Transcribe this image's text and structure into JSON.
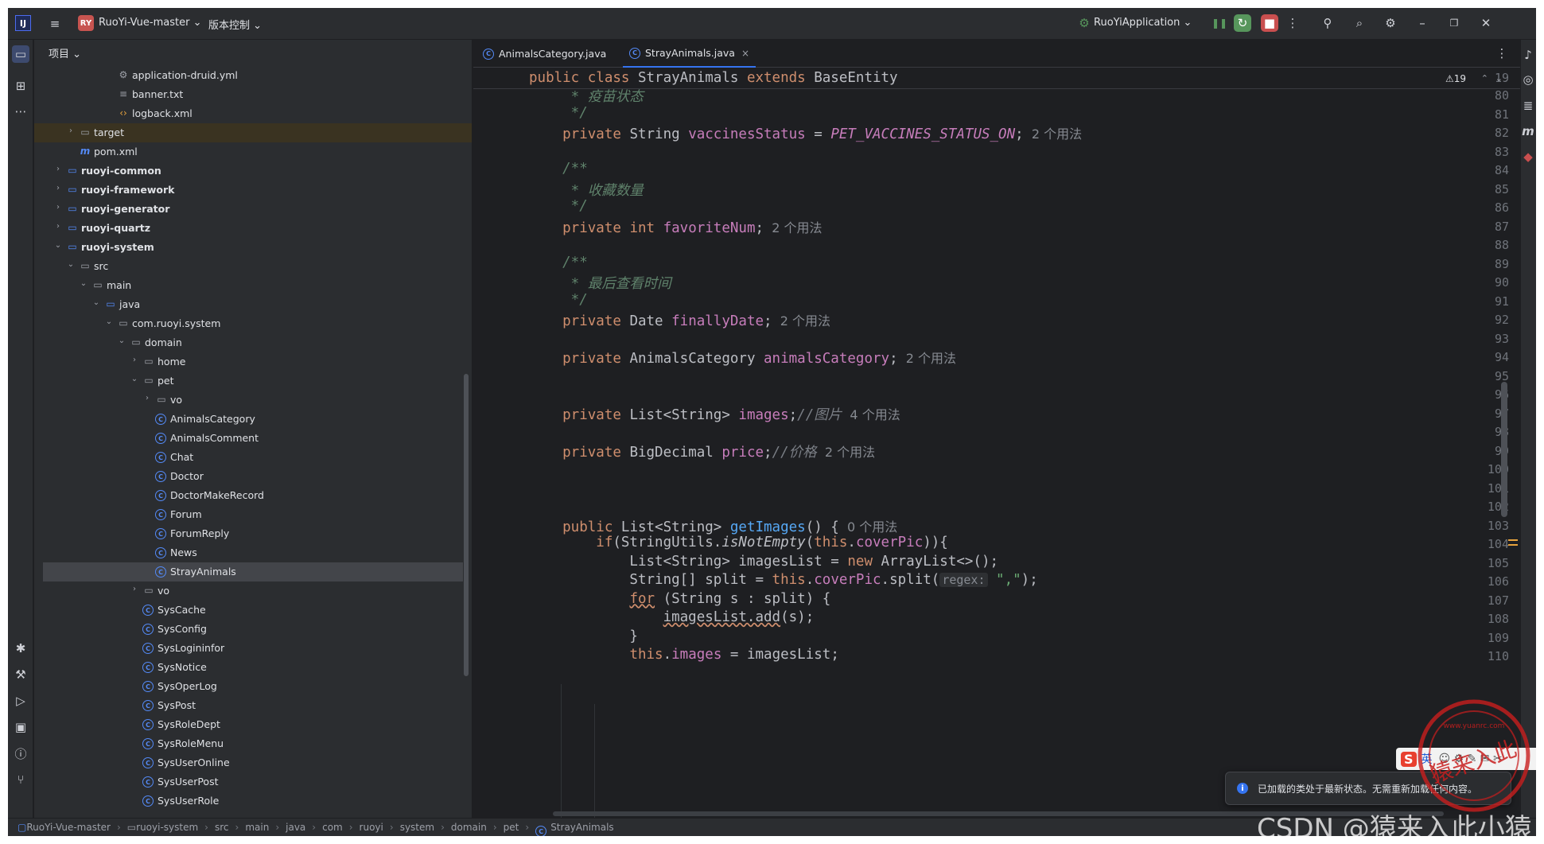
{
  "titlebar": {
    "logo": "IJ",
    "project_badge": "RY",
    "project_name": "RuoYi-Vue-master ⌄",
    "vcs_label": "版本控制 ⌄",
    "run_config": "RuoYiApplication ⌄",
    "icons": [
      "hamburger-icon",
      "run-config-icon",
      "debug-pause-icon",
      "rerun-icon",
      "stop-icon",
      "more-icon",
      "add-user-icon",
      "search-icon",
      "settings-icon",
      "minimize-icon",
      "maximize-icon",
      "close-icon"
    ]
  },
  "left_strip": {
    "icons": [
      "project-folder-icon",
      "structure-icon",
      "more-dots-icon",
      "debug-bug-icon",
      "build-hammer-icon",
      "services-play-icon",
      "terminal-icon",
      "problems-icon",
      "git-icon"
    ]
  },
  "project_panel": {
    "title": "项目 ⌄",
    "tree": [
      {
        "label": "application-druid.yml",
        "depth": 6,
        "icon": "yml",
        "arrow": ""
      },
      {
        "label": "banner.txt",
        "depth": 6,
        "icon": "txt",
        "arrow": ""
      },
      {
        "label": "logback.xml",
        "depth": 6,
        "icon": "xml",
        "arrow": ""
      },
      {
        "label": "target",
        "depth": 3,
        "icon": "folder",
        "arrow": "›",
        "excluded": true
      },
      {
        "label": "pom.xml",
        "depth": 3,
        "icon": "maven",
        "arrow": ""
      },
      {
        "label": "ruoyi-common",
        "depth": 2,
        "icon": "module",
        "arrow": "›",
        "bold": true
      },
      {
        "label": "ruoyi-framework",
        "depth": 2,
        "icon": "module",
        "arrow": "›",
        "bold": true
      },
      {
        "label": "ruoyi-generator",
        "depth": 2,
        "icon": "module",
        "arrow": "›",
        "bold": true
      },
      {
        "label": "ruoyi-quartz",
        "depth": 2,
        "icon": "module",
        "arrow": "›",
        "bold": true
      },
      {
        "label": "ruoyi-system",
        "depth": 2,
        "icon": "module",
        "arrow": "⌄",
        "bold": true
      },
      {
        "label": "src",
        "depth": 3,
        "icon": "folder",
        "arrow": "⌄"
      },
      {
        "label": "main",
        "depth": 4,
        "icon": "folder",
        "arrow": "⌄"
      },
      {
        "label": "java",
        "depth": 5,
        "icon": "module",
        "arrow": "⌄"
      },
      {
        "label": "com.ruoyi.system",
        "depth": 6,
        "icon": "package",
        "arrow": "⌄"
      },
      {
        "label": "domain",
        "depth": 7,
        "icon": "package",
        "arrow": "⌄"
      },
      {
        "label": "home",
        "depth": 8,
        "icon": "package",
        "arrow": "›"
      },
      {
        "label": "pet",
        "depth": 8,
        "icon": "package",
        "arrow": "⌄"
      },
      {
        "label": "vo",
        "depth": 9,
        "icon": "package",
        "arrow": "›"
      },
      {
        "label": "AnimalsCategory",
        "depth": 9,
        "icon": "class",
        "arrow": ""
      },
      {
        "label": "AnimalsComment",
        "depth": 9,
        "icon": "class",
        "arrow": ""
      },
      {
        "label": "Chat",
        "depth": 9,
        "icon": "class",
        "arrow": ""
      },
      {
        "label": "Doctor",
        "depth": 9,
        "icon": "class",
        "arrow": ""
      },
      {
        "label": "DoctorMakeRecord",
        "depth": 9,
        "icon": "class",
        "arrow": ""
      },
      {
        "label": "Forum",
        "depth": 9,
        "icon": "class",
        "arrow": ""
      },
      {
        "label": "ForumReply",
        "depth": 9,
        "icon": "class",
        "arrow": ""
      },
      {
        "label": "News",
        "depth": 9,
        "icon": "class",
        "arrow": ""
      },
      {
        "label": "StrayAnimals",
        "depth": 9,
        "icon": "class",
        "arrow": "",
        "selected": true
      },
      {
        "label": "vo",
        "depth": 8,
        "icon": "package",
        "arrow": "›"
      },
      {
        "label": "SysCache",
        "depth": 8,
        "icon": "class",
        "arrow": ""
      },
      {
        "label": "SysConfig",
        "depth": 8,
        "icon": "class",
        "arrow": ""
      },
      {
        "label": "SysLogininfor",
        "depth": 8,
        "icon": "class",
        "arrow": ""
      },
      {
        "label": "SysNotice",
        "depth": 8,
        "icon": "class",
        "arrow": ""
      },
      {
        "label": "SysOperLog",
        "depth": 8,
        "icon": "class",
        "arrow": ""
      },
      {
        "label": "SysPost",
        "depth": 8,
        "icon": "class",
        "arrow": ""
      },
      {
        "label": "SysRoleDept",
        "depth": 8,
        "icon": "class",
        "arrow": ""
      },
      {
        "label": "SysRoleMenu",
        "depth": 8,
        "icon": "class",
        "arrow": ""
      },
      {
        "label": "SysUserOnline",
        "depth": 8,
        "icon": "class",
        "arrow": ""
      },
      {
        "label": "SysUserPost",
        "depth": 8,
        "icon": "class",
        "arrow": ""
      },
      {
        "label": "SysUserRole",
        "depth": 8,
        "icon": "class",
        "arrow": ""
      }
    ]
  },
  "editor": {
    "tabs": [
      {
        "label": "AnimalsCategory.java",
        "active": false
      },
      {
        "label": "StrayAnimals.java",
        "active": true
      }
    ],
    "tab_close": "×",
    "warning_count": "⚠19",
    "sticky_line": {
      "number": "19",
      "segments": [
        {
          "t": "public class ",
          "c": "kw"
        },
        {
          "t": "StrayAnimals",
          "c": "typ"
        },
        {
          "t": " extends ",
          "c": "kw"
        },
        {
          "t": "BaseEntity",
          "c": "typ"
        }
      ]
    },
    "lines": [
      {
        "n": "80",
        "segs": [
          {
            "t": "     * 疫苗状态",
            "c": "doc"
          }
        ]
      },
      {
        "n": "81",
        "segs": [
          {
            "t": "     */",
            "c": "doc"
          }
        ]
      },
      {
        "n": "82",
        "segs": [
          {
            "t": "    private ",
            "c": "kw"
          },
          {
            "t": "String ",
            "c": "typ"
          },
          {
            "t": "vaccinesStatus",
            "c": "fld"
          },
          {
            "t": " = ",
            "c": "typ"
          },
          {
            "t": "PET_VACCINES_STATUS_ON",
            "c": "cst"
          },
          {
            "t": ";",
            "c": "typ"
          },
          {
            "t": "  2 个用法",
            "c": "hint"
          }
        ]
      },
      {
        "n": "83",
        "segs": []
      },
      {
        "n": "84",
        "segs": [
          {
            "t": "    /**",
            "c": "doc"
          }
        ]
      },
      {
        "n": "85",
        "segs": [
          {
            "t": "     * 收藏数量",
            "c": "doc"
          }
        ]
      },
      {
        "n": "86",
        "segs": [
          {
            "t": "     */",
            "c": "doc"
          }
        ]
      },
      {
        "n": "87",
        "segs": [
          {
            "t": "    private ",
            "c": "kw"
          },
          {
            "t": "int ",
            "c": "kw"
          },
          {
            "t": "favoriteNum",
            "c": "fld"
          },
          {
            "t": ";",
            "c": "typ"
          },
          {
            "t": "  2 个用法",
            "c": "hint"
          }
        ]
      },
      {
        "n": "88",
        "segs": []
      },
      {
        "n": "89",
        "segs": [
          {
            "t": "    /**",
            "c": "doc"
          }
        ]
      },
      {
        "n": "90",
        "segs": [
          {
            "t": "     * 最后查看时间",
            "c": "doc"
          }
        ]
      },
      {
        "n": "91",
        "segs": [
          {
            "t": "     */",
            "c": "doc"
          }
        ]
      },
      {
        "n": "92",
        "segs": [
          {
            "t": "    private ",
            "c": "kw"
          },
          {
            "t": "Date ",
            "c": "typ"
          },
          {
            "t": "finallyDate",
            "c": "fld"
          },
          {
            "t": ";",
            "c": "typ"
          },
          {
            "t": "  2 个用法",
            "c": "hint"
          }
        ]
      },
      {
        "n": "93",
        "segs": []
      },
      {
        "n": "94",
        "segs": [
          {
            "t": "    private ",
            "c": "kw"
          },
          {
            "t": "AnimalsCategory ",
            "c": "typ"
          },
          {
            "t": "animalsCategory",
            "c": "fld"
          },
          {
            "t": ";",
            "c": "typ"
          },
          {
            "t": "  2 个用法",
            "c": "hint"
          }
        ]
      },
      {
        "n": "95",
        "segs": []
      },
      {
        "n": "96",
        "segs": []
      },
      {
        "n": "97",
        "segs": [
          {
            "t": "    private ",
            "c": "kw"
          },
          {
            "t": "List<String> ",
            "c": "typ"
          },
          {
            "t": "images",
            "c": "fld"
          },
          {
            "t": ";",
            "c": "typ"
          },
          {
            "t": "//图片",
            "c": "cmt"
          },
          {
            "t": "  4 个用法",
            "c": "hint"
          }
        ]
      },
      {
        "n": "98",
        "segs": []
      },
      {
        "n": "99",
        "segs": [
          {
            "t": "    private ",
            "c": "kw"
          },
          {
            "t": "BigDecimal ",
            "c": "typ"
          },
          {
            "t": "price",
            "c": "fld"
          },
          {
            "t": ";",
            "c": "typ"
          },
          {
            "t": "//价格",
            "c": "cmt"
          },
          {
            "t": "  2 个用法",
            "c": "hint"
          }
        ]
      },
      {
        "n": "100",
        "segs": []
      },
      {
        "n": "101",
        "segs": []
      },
      {
        "n": "102",
        "segs": []
      },
      {
        "n": "103",
        "segs": [
          {
            "t": "    public ",
            "c": "kw"
          },
          {
            "t": "List<String> ",
            "c": "typ"
          },
          {
            "t": "getImages",
            "c": "mth"
          },
          {
            "t": "() {",
            "c": "typ"
          },
          {
            "t": "  0 个用法",
            "c": "hint"
          }
        ]
      },
      {
        "n": "104",
        "segs": [
          {
            "t": "        if",
            "c": "kw"
          },
          {
            "t": "(StringUtils.",
            "c": "typ"
          },
          {
            "t": "isNotEmpty",
            "c": "ital"
          },
          {
            "t": "(",
            "c": "typ"
          },
          {
            "t": "this",
            "c": "kw"
          },
          {
            "t": ".",
            "c": "typ"
          },
          {
            "t": "coverPic",
            "c": "fld"
          },
          {
            "t": ")){",
            "c": "typ"
          }
        ]
      },
      {
        "n": "105",
        "segs": [
          {
            "t": "            List<String> imagesList = ",
            "c": "typ"
          },
          {
            "t": "new ",
            "c": "kw"
          },
          {
            "t": "ArrayList<>();",
            "c": "typ"
          }
        ]
      },
      {
        "n": "106",
        "segs": [
          {
            "t": "            String[] split = ",
            "c": "typ"
          },
          {
            "t": "this",
            "c": "kw"
          },
          {
            "t": ".",
            "c": "typ"
          },
          {
            "t": "coverPic",
            "c": "fld"
          },
          {
            "t": ".split(",
            "c": "typ"
          },
          {
            "t": "regex:",
            "c": "param"
          },
          {
            "t": " \",\"",
            "c": "str"
          },
          {
            "t": ");",
            "c": "typ"
          }
        ]
      },
      {
        "n": "107",
        "segs": [
          {
            "t": "            ",
            "c": "typ"
          },
          {
            "t": "for",
            "c": "kw uline"
          },
          {
            "t": " (String s : split) {",
            "c": "typ"
          }
        ]
      },
      {
        "n": "108",
        "segs": [
          {
            "t": "                ",
            "c": "typ"
          },
          {
            "t": "imagesList.add",
            "c": "typ uline"
          },
          {
            "t": "(s);",
            "c": "typ"
          }
        ]
      },
      {
        "n": "109",
        "segs": [
          {
            "t": "            }",
            "c": "typ"
          }
        ]
      },
      {
        "n": "110",
        "segs": [
          {
            "t": "            ",
            "c": "typ"
          },
          {
            "t": "this",
            "c": "kw"
          },
          {
            "t": ".",
            "c": "typ"
          },
          {
            "t": "images",
            "c": "fld"
          },
          {
            "t": " = imagesList;",
            "c": "typ"
          }
        ]
      }
    ]
  },
  "right_strip": {
    "icons": [
      "notifications-icon",
      "ai-assistant-icon",
      "database-icon",
      "maven-icon",
      "plugin-icon"
    ]
  },
  "statusbar": {
    "crumbs": [
      "RuoYi-Vue-master",
      "ruoyi-system",
      "src",
      "main",
      "java",
      "com",
      "ruoyi",
      "system",
      "domain",
      "pet",
      "StrayAnimals"
    ]
  },
  "toast": {
    "text": "已加载的类处于最新状态。无需重新加载任何内容。"
  },
  "watermark": {
    "text": "CSDN @猿来入此小猿",
    "seal_text": "猿来入此",
    "seal_url": "www.yuanrc.com",
    "ime_label": "英",
    "ime_logo": "S"
  }
}
